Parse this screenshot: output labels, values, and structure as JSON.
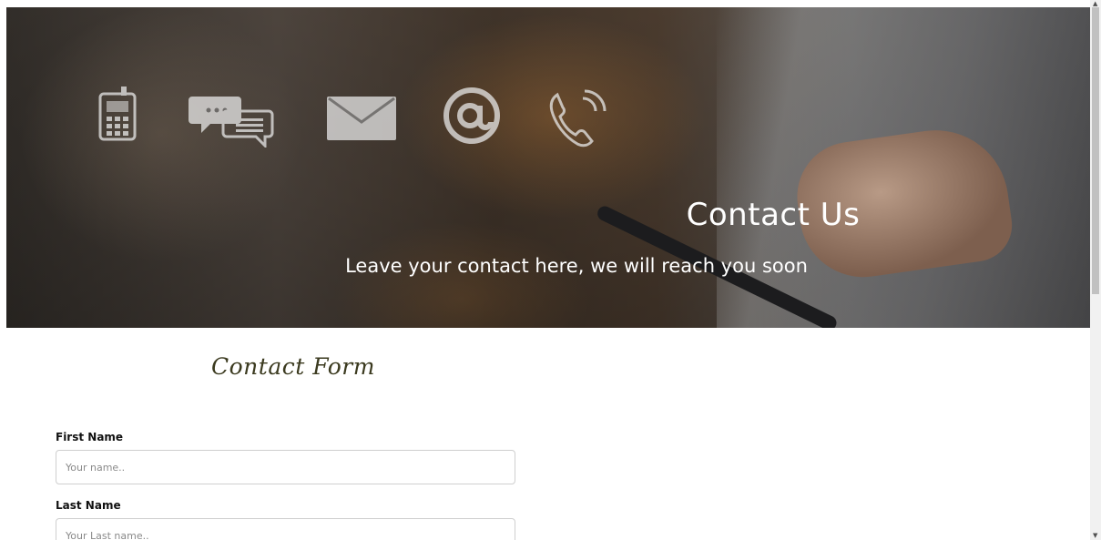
{
  "hero": {
    "title": "Contact Us",
    "subtitle": "Leave your contact here, we will reach you soon",
    "icons": [
      "mobile-phone-icon",
      "chat-bubbles-icon",
      "envelope-icon",
      "at-sign-icon",
      "phone-handset-icon"
    ]
  },
  "form": {
    "heading": "Contact Form",
    "fields": [
      {
        "label": "First Name",
        "placeholder": "Your name..",
        "value": ""
      },
      {
        "label": "Last Name",
        "placeholder": "Your Last name..",
        "value": ""
      }
    ]
  },
  "colors": {
    "heading": "#3b3a1f",
    "hero_text": "#ffffff",
    "input_border": "#cfcfcf"
  }
}
